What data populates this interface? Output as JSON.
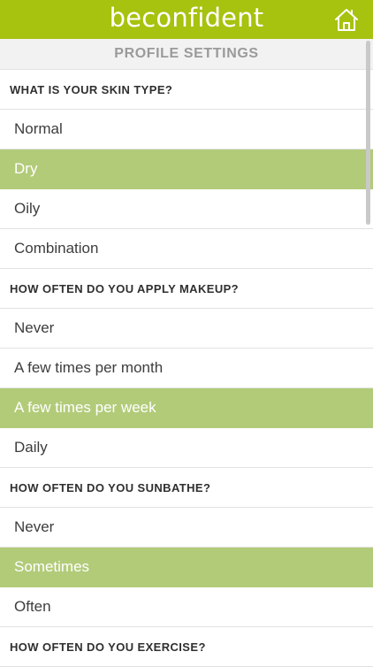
{
  "header": {
    "brand": "beconfident",
    "home_icon": "home-icon"
  },
  "subheader": {
    "title": "PROFILE SETTINGS"
  },
  "sections": [
    {
      "question": "WHAT IS YOUR SKIN TYPE?",
      "options": [
        "Normal",
        "Dry",
        "Oily",
        "Combination"
      ],
      "selected": "Dry"
    },
    {
      "question": "HOW OFTEN DO YOU APPLY MAKEUP?",
      "options": [
        "Never",
        "A few times per month",
        "A few times per week",
        "Daily"
      ],
      "selected": "A few times per week"
    },
    {
      "question": "HOW OFTEN DO YOU SUNBATHE?",
      "options": [
        "Never",
        "Sometimes",
        "Often"
      ],
      "selected": "Sometimes"
    },
    {
      "question": "HOW OFTEN DO YOU EXERCISE?",
      "options": [],
      "selected": ""
    }
  ],
  "colors": {
    "brand_green": "#a7c20f",
    "selected_green": "#b2cb79"
  }
}
